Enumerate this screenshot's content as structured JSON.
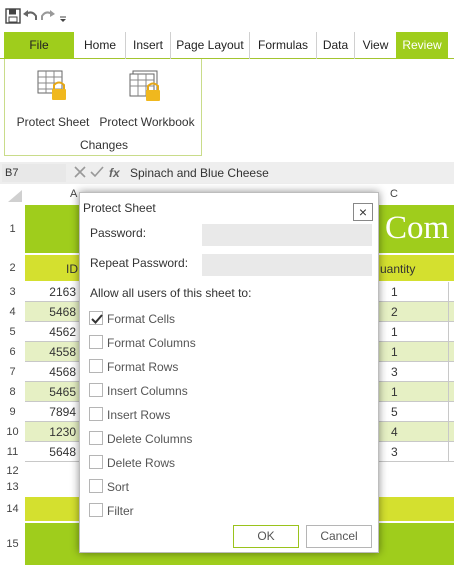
{
  "qat": {
    "icons": [
      "save-icon",
      "undo-icon",
      "redo-icon",
      "dropdown-arrow-icon"
    ]
  },
  "tabs": [
    {
      "label": "File"
    },
    {
      "label": "Home"
    },
    {
      "label": "Insert"
    },
    {
      "label": "Page Layout"
    },
    {
      "label": "Formulas"
    },
    {
      "label": "Data"
    },
    {
      "label": "View"
    },
    {
      "label": "Review"
    }
  ],
  "ribbon": {
    "protect_sheet": "Protect Sheet",
    "protect_workbook": "Protect Workbook",
    "group_label": "Changes"
  },
  "formula_bar": {
    "cell_ref": "B7",
    "fx": "fx",
    "content": "Spinach and Blue Cheese"
  },
  "grid": {
    "col_a": "A",
    "col_c": "C",
    "title_partial": "Com",
    "header_a": "ID",
    "header_c": "uantity",
    "rows": [
      {
        "num": "1"
      },
      {
        "num": "2"
      },
      {
        "num": "3",
        "a": "2163",
        "c": "1"
      },
      {
        "num": "4",
        "a": "5468",
        "c": "2"
      },
      {
        "num": "5",
        "a": "4562",
        "c": "1"
      },
      {
        "num": "6",
        "a": "4558",
        "c": "1"
      },
      {
        "num": "7",
        "a": "4568",
        "c": "3"
      },
      {
        "num": "8",
        "a": "5465",
        "c": "1"
      },
      {
        "num": "9",
        "a": "7894",
        "c": "5"
      },
      {
        "num": "10",
        "a": "1230",
        "c": "4"
      },
      {
        "num": "11",
        "a": "5648",
        "c": "3"
      },
      {
        "num": "12"
      },
      {
        "num": "13"
      },
      {
        "num": "14"
      },
      {
        "num": "15"
      }
    ]
  },
  "dialog": {
    "title": "Protect Sheet",
    "close": "×",
    "password_label": "Password:",
    "repeat_label": "Repeat Password:",
    "allow_label": "Allow all users of this sheet to:",
    "options": [
      {
        "label": "Format Cells",
        "checked": true
      },
      {
        "label": "Format Columns",
        "checked": false
      },
      {
        "label": "Format Rows",
        "checked": false
      },
      {
        "label": "Insert Columns",
        "checked": false
      },
      {
        "label": "Insert Rows",
        "checked": false
      },
      {
        "label": "Delete Columns",
        "checked": false
      },
      {
        "label": "Delete Rows",
        "checked": false
      },
      {
        "label": "Sort",
        "checked": false
      },
      {
        "label": "Filter",
        "checked": false
      }
    ],
    "ok": "OK",
    "cancel": "Cancel"
  },
  "colors": {
    "accent": "#9fcd1c",
    "header_fill": "#d4e02f",
    "stripe": "#e6f0c4"
  }
}
